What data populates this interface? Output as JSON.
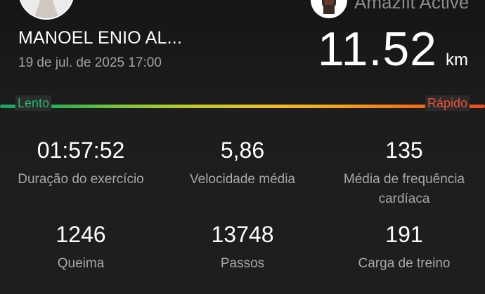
{
  "header": {
    "user_name": "MANOEL ENIO AL...",
    "date": "19 de jul. de 2025 17:00",
    "device_name": "Amazfit Active",
    "distance_value": "11.52",
    "distance_unit": "km"
  },
  "pace_bar": {
    "slow_label": "Lento",
    "fast_label": "Rápido",
    "colors": {
      "slow": "#1aa36a",
      "mid": "#f2b928",
      "fast": "#ea4b1f"
    }
  },
  "stats": [
    {
      "value": "01:57:52",
      "label": "Duração do exercício"
    },
    {
      "value": "5,86",
      "label": "Velocidade média"
    },
    {
      "value": "135",
      "label": "Média de frequência cardíaca"
    },
    {
      "value": "1246",
      "label": "Queima"
    },
    {
      "value": "13748",
      "label": "Passos"
    },
    {
      "value": "191",
      "label": "Carga de treino"
    }
  ],
  "icons": {
    "avatar": "user-avatar",
    "device": "smartwatch-icon"
  }
}
